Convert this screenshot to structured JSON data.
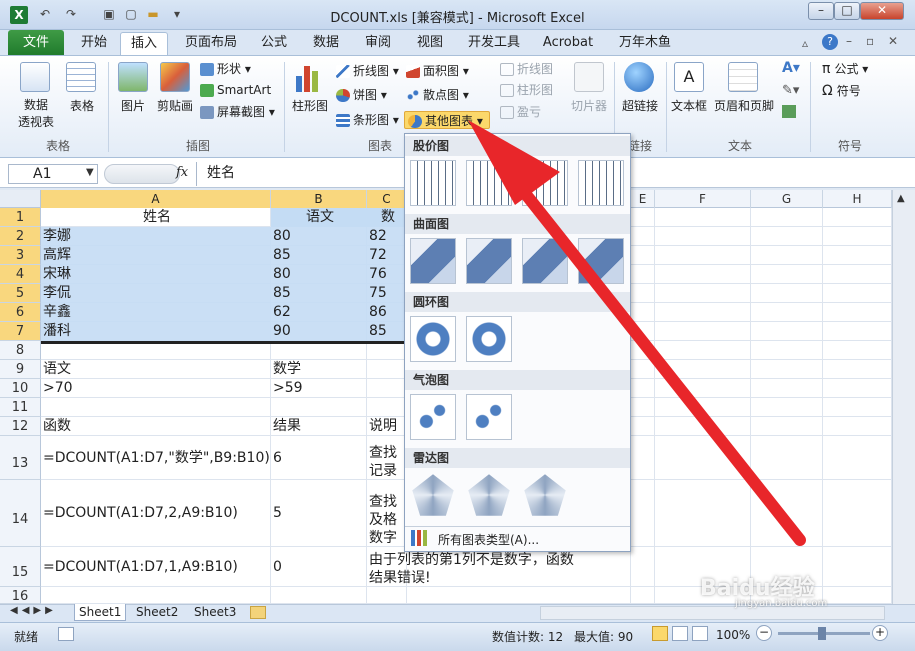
{
  "window": {
    "title": "DCOUNT.xls  [兼容模式] - Microsoft Excel"
  },
  "tabs": [
    "文件",
    "开始",
    "插入",
    "页面布局",
    "公式",
    "数据",
    "审阅",
    "视图",
    "开发工具",
    "Acrobat",
    "万年木鱼"
  ],
  "ribbon": {
    "pivot_label": "数据\n透视表",
    "table_label": "表格",
    "group_table": "表格",
    "picture_label": "图片",
    "clipart_label": "剪贴画",
    "shapes_label": "形状",
    "smartart_label": "SmartArt",
    "screenshot_label": "屏幕截图",
    "group_illust": "插图",
    "column_label": "柱形图",
    "line_label": "折线图",
    "pie_label": "饼图",
    "bar_label": "条形图",
    "area_label": "面积图",
    "scatter_label": "散点图",
    "other_label": "其他图表",
    "group_chart": "图表",
    "spark_line": "折线图",
    "spark_col": "柱形图",
    "spark_wl": "盈亏",
    "slicer": "切片器",
    "hyperlink": "超链接",
    "group_link": "链接",
    "textbox": "文本框",
    "header_footer": "页眉和页脚",
    "group_text": "文本",
    "formula": "公式",
    "symbol": "符号",
    "group_symbol": "符号"
  },
  "formula_bar": {
    "name_box": "A1",
    "fx": "fx",
    "content": "姓名"
  },
  "columns": [
    "A",
    "B",
    "C",
    "D",
    "E",
    "F",
    "G",
    "H"
  ],
  "rows": [
    "1",
    "2",
    "3",
    "4",
    "5",
    "6",
    "7",
    "8",
    "9",
    "10",
    "11",
    "12",
    "13",
    "14",
    "15",
    "16"
  ],
  "cells": {
    "r1": [
      "姓名",
      "语文",
      "数"
    ],
    "r2": [
      "李娜",
      "80",
      "82"
    ],
    "r3": [
      "高辉",
      "85",
      "72"
    ],
    "r4": [
      "宋琳",
      "80",
      "76"
    ],
    "r5": [
      "李侃",
      "85",
      "75"
    ],
    "r6": [
      "辛鑫",
      "62",
      "86"
    ],
    "r7": [
      "潘科",
      "90",
      "85"
    ],
    "r9": [
      "语文",
      "数学"
    ],
    "r10": [
      ">70",
      ">59"
    ],
    "r12": [
      "函数",
      "结果",
      "说明"
    ],
    "r13": [
      "=DCOUNT(A1:D7,\"数学\",B9:B10)",
      "6",
      "查找\n记录"
    ],
    "r14": [
      "=DCOUNT(A1:D7,2,A9:B10)",
      "5",
      "查找\n及格\n数字"
    ],
    "r15": [
      "=DCOUNT(A1:D7,1,A9:B10)",
      "0",
      "由于列表的第1列不是数字，函数\n结果错误!"
    ]
  },
  "sheets": [
    "Sheet1",
    "Sheet2",
    "Sheet3"
  ],
  "status": {
    "ready": "就绪",
    "count": "数值计数: 12",
    "max": "最大值: 90",
    "zoom": "100%"
  },
  "menu": {
    "sections": [
      "股价图",
      "曲面图",
      "圆环图",
      "气泡图",
      "雷达图"
    ],
    "all_types": "所有图表类型(A)..."
  },
  "watermark": "Baidu经验",
  "watermark_url": "jingyan.baidu.com"
}
